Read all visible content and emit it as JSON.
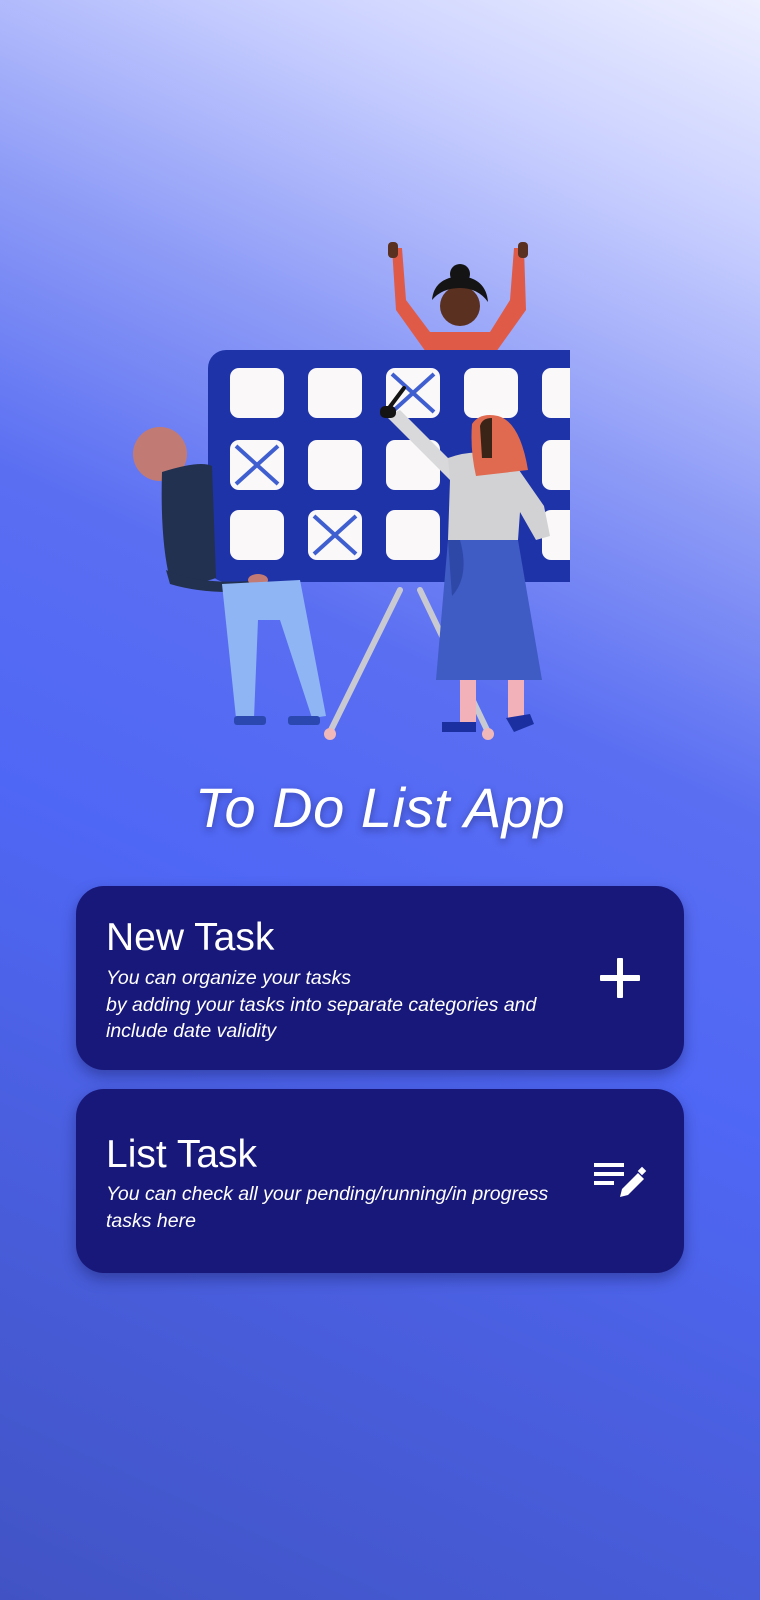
{
  "app": {
    "title": "To Do List App"
  },
  "illustration": {
    "name": "people-with-task-board-illustration"
  },
  "cards": {
    "new_task": {
      "title": "New Task",
      "description": "You can organize your tasks\nby adding your tasks into separate categories and include date validity",
      "icon": "plus-icon"
    },
    "list_task": {
      "title": "List Task",
      "description": "You can check all your pending/running/in progress tasks here",
      "icon": "list-edit-icon"
    }
  },
  "colors": {
    "card_background": "#18187a",
    "board_frame": "#1e33a8",
    "board_cell": "#faf8f8",
    "gradient_top": "#eef0ff",
    "gradient_mid": "#4f67f5",
    "gradient_bottom": "#4153c4"
  }
}
